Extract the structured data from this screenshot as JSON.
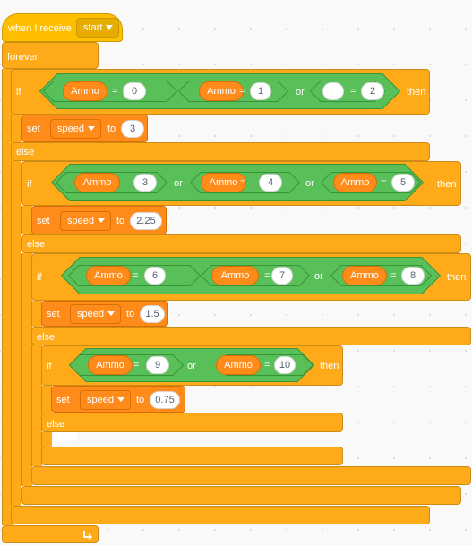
{
  "hat": {
    "label": "when I receive",
    "message": "start"
  },
  "forever_label": "forever",
  "keywords": {
    "if": "if",
    "then": "then",
    "else": "else",
    "or": "or",
    "set": "set",
    "to": "to",
    "equals": "="
  },
  "variable_dropdown": "speed",
  "branches": [
    {
      "conditions": [
        {
          "left": "Ammo",
          "right": "0"
        },
        {
          "left": "Ammo",
          "right": "1"
        },
        {
          "left": "",
          "right": "2"
        }
      ],
      "speed": "3"
    },
    {
      "conditions": [
        {
          "left": "Ammo",
          "right": "3"
        },
        {
          "left": "Ammo",
          "right": "4"
        },
        {
          "left": "Ammo",
          "right": "5"
        }
      ],
      "speed": "2.25"
    },
    {
      "conditions": [
        {
          "left": "Ammo",
          "right": "6"
        },
        {
          "left": "Ammo",
          "right": "7"
        },
        {
          "left": "Ammo",
          "right": "8"
        }
      ],
      "speed": "1.5"
    },
    {
      "conditions": [
        {
          "left": "Ammo",
          "right": "9"
        },
        {
          "left": "Ammo",
          "right": "10"
        }
      ],
      "speed": "0.75"
    }
  ],
  "colors": {
    "control": "#ffab19",
    "variables": "#ff8c1a",
    "operators": "#59c059",
    "events": "#ffbf00"
  },
  "icons": {
    "loop_arrow": "loop-arrow-icon",
    "dropdown": "caret-down-icon"
  }
}
